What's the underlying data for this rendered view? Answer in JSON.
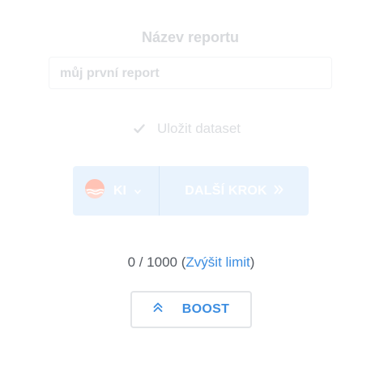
{
  "report": {
    "label": "Název reportu",
    "name_value": "můj první report"
  },
  "dataset": {
    "save_label": "Uložit dataset",
    "checked": true
  },
  "actions": {
    "model_label": "KI",
    "next_label": "DALŠÍ KROK"
  },
  "limit": {
    "usage": "0 / 1000",
    "open_paren": "(",
    "link_label": "Zvýšit limit",
    "close_paren": ")"
  },
  "boost": {
    "label": "BOOST"
  },
  "colors": {
    "accent": "#3d8ee1",
    "bar_background": "#e9f3fd",
    "muted_text": "#d9dbde"
  },
  "icons": [
    "check-icon",
    "sunset-logo-icon",
    "chevron-down-icon",
    "double-chevron-right-icon",
    "double-chevron-up-icon"
  ]
}
